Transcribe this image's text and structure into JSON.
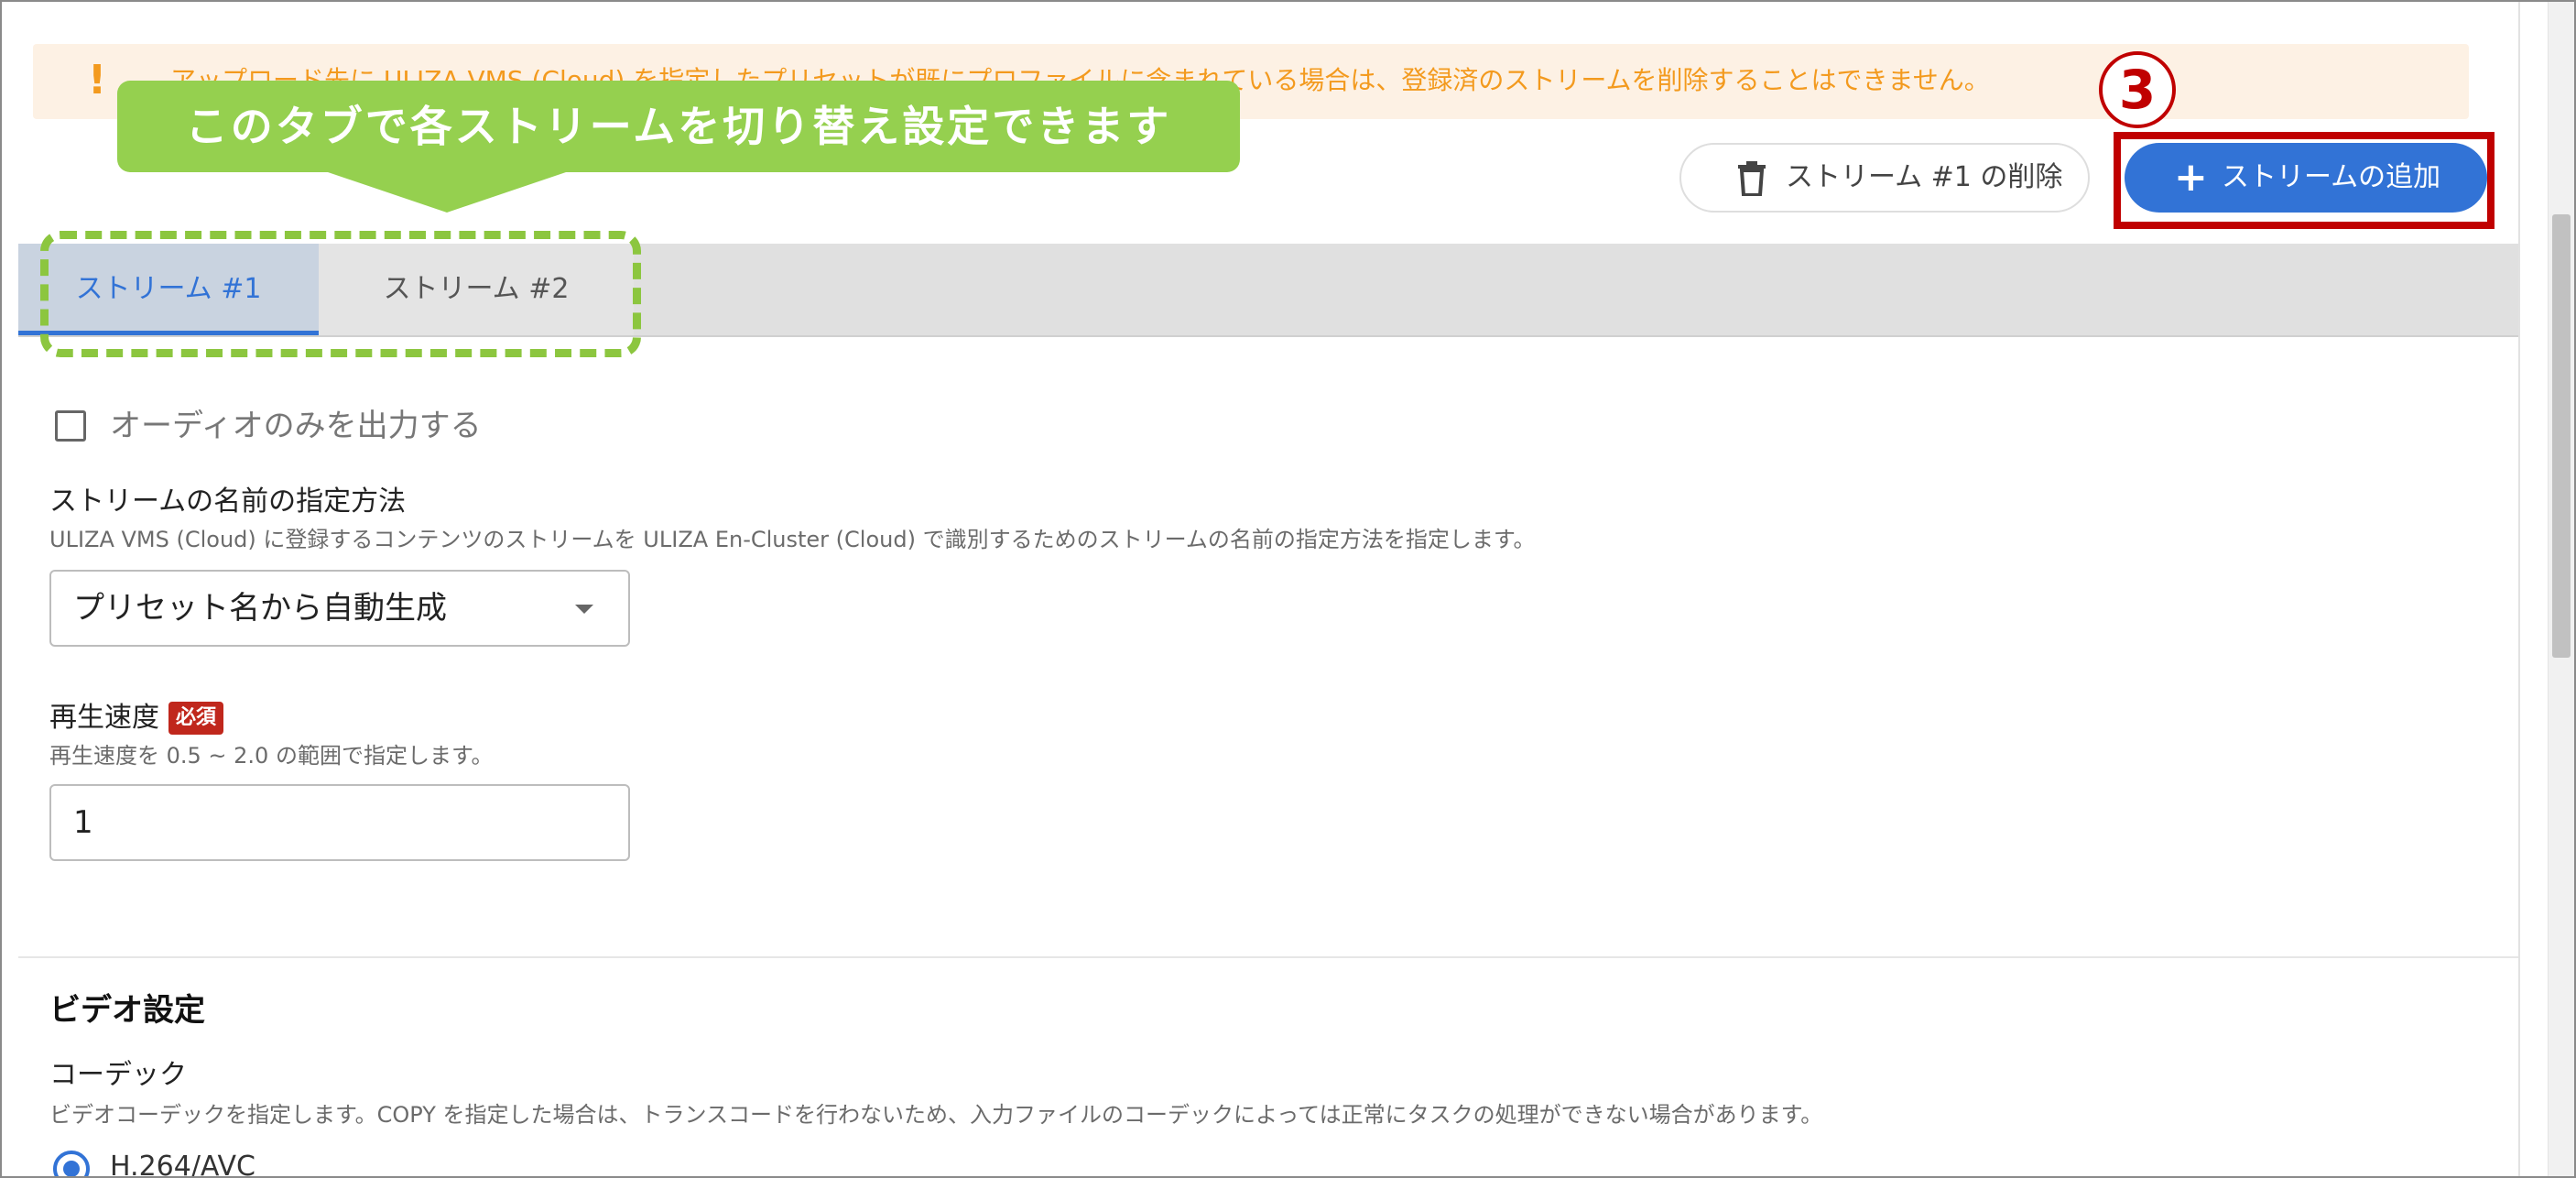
{
  "warning": {
    "text": "アップロード先に ULIZA VMS (Cloud) を指定したプリセットが既にプロファイルに含まれている場合は、登録済のストリームを削除することはできません。"
  },
  "callout": {
    "text": "このタブで各ストリームを切り替え設定できます"
  },
  "step_number": "3",
  "actions": {
    "delete_label": "ストリーム #1 の削除",
    "add_label": "ストリームの追加"
  },
  "tabs": [
    {
      "label": "ストリーム #1"
    },
    {
      "label": "ストリーム #2"
    }
  ],
  "audio_only": {
    "label": "オーディオのみを出力する"
  },
  "stream_name": {
    "label": "ストリームの名前の指定方法",
    "help": "ULIZA VMS (Cloud) に登録するコンテンツのストリームを ULIZA En-Cluster (Cloud) で識別するためのストリームの名前の指定方法を指定します。",
    "value": "プリセット名から自動生成"
  },
  "playback_speed": {
    "label": "再生速度",
    "required": "必須",
    "help": "再生速度を 0.5 ~ 2.0 の範囲で指定します。",
    "value": "1"
  },
  "video_settings": {
    "title": "ビデオ設定",
    "codec_label": "コーデック",
    "codec_help": "ビデオコーデックを指定します。COPY を指定した場合は、トランスコードを行わないため、入力ファイルのコーデックによっては正常にタスクの処理ができない場合があります。",
    "codec_option": "H.264/AVC"
  },
  "colors": {
    "accent": "#3273d6",
    "callout": "#95d04f",
    "highlight": "#c00000",
    "warning": "#f39a1e"
  }
}
